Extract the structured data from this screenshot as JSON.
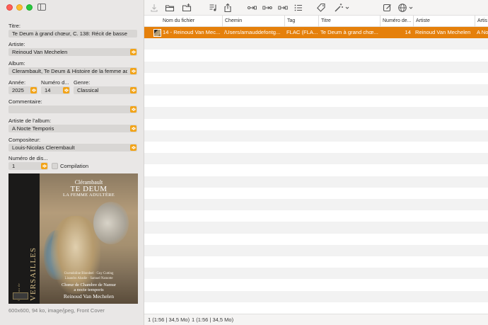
{
  "window": {
    "controls": [
      "close",
      "minimize",
      "zoom"
    ],
    "sidebar_toggle_icon": "sidebar-icon"
  },
  "sidebar": {
    "title": {
      "label": "Titre:",
      "value": "Te Deum à grand chœur, C. 138: Récit de basse"
    },
    "artist": {
      "label": "Artiste:",
      "value": "Reinoud Van Mechelen"
    },
    "album": {
      "label": "Album:",
      "value": "Clerambault, Te Deum & Histoire de la femme ad"
    },
    "year": {
      "label": "Année:",
      "value": "2025"
    },
    "track_number": {
      "label": "Numéro d...",
      "value": "14"
    },
    "genre": {
      "label": "Genre:",
      "value": "Classical"
    },
    "comment": {
      "label": "Commentaire:",
      "value": ""
    },
    "album_artist": {
      "label": "Artiste de l'album:",
      "value": "A Nocte Temporis"
    },
    "composer": {
      "label": "Compositeur:",
      "value": "Louis-Nicolas Clerembault"
    },
    "disc_number": {
      "label": "Numéro de dis...",
      "value": "1"
    },
    "compilation": {
      "label": "Compilation",
      "checked": false
    },
    "cover": {
      "composer": "Clérambault",
      "title": "TE DEUM",
      "subtitle": "LA FEMME ADULTÈRE",
      "performers_line1": "Gwendoline Blondeel · Guy Cutting",
      "performers_line2": "Lisandro Abadie · Samuel Namotte",
      "choir_line1": "Chœur de Chambre de Namur",
      "choir_line2": "a nocte temporis",
      "performer": "Reinoud Van Mechelen",
      "spine": "VERSAILLES",
      "spine_sub": "Château de"
    },
    "cover_info": "600x600, 94 ko, image/jpeg, Front Cover"
  },
  "toolbar": {
    "icons": [
      "save-icon",
      "folder-icon",
      "folder-plus-icon",
      "music-list-icon",
      "share-icon",
      "tag-to-filename-icon",
      "filename-to-tag-icon",
      "tag-to-tag-icon",
      "list-icon",
      "tag-icon",
      "wand-icon",
      "dropdown-icon",
      "edit-icon",
      "globe-icon",
      "dropdown-icon"
    ]
  },
  "table": {
    "columns": [
      "Nom du fichier",
      "Chemin",
      "Tag",
      "Titre",
      "Numéro de...",
      "Artiste",
      "Artis"
    ],
    "rows": [
      {
        "filename": "14 - Reinoud Van Mec...",
        "path": "/Users/arnauddefontg...",
        "tag": "FLAC (FLA...",
        "title": "Te Deum à grand chœ...",
        "track": "14",
        "artist": "Reinoud Van Mechelen",
        "album_artist": "A No"
      }
    ],
    "selected_row": 0
  },
  "status": {
    "left": "1 (1:56 | 34,5 Mo)",
    "right": "1 (1:56 | 34,5 Mo)"
  },
  "colors": {
    "accent": "#e5800b",
    "stepper": "#f2a317",
    "sidebar_bg": "#e9e7e6",
    "field_bg": "#d8d6d4",
    "row_alt": "#f2f2f2"
  }
}
